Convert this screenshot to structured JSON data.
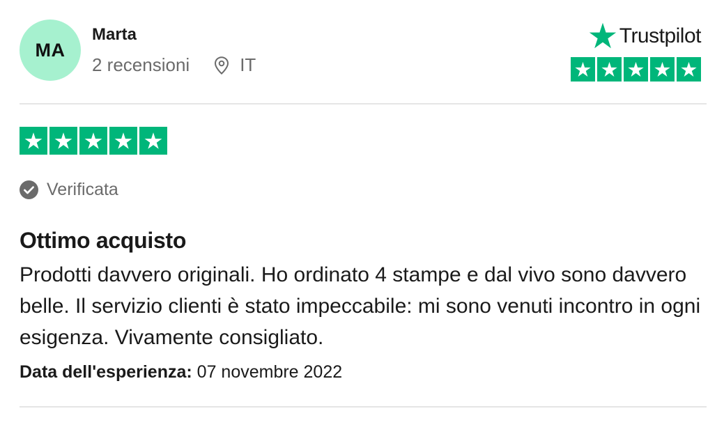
{
  "reviewer": {
    "initials": "MA",
    "name": "Marta",
    "reviews_count": "2 recensioni",
    "country": "IT",
    "avatar_color": "#a6f1cf"
  },
  "brand": {
    "name": "Trustpilot",
    "logo_icon": "trustpilot-star-icon",
    "accent_color": "#00b67a",
    "logo_stars": 5
  },
  "review": {
    "rating": 5,
    "rating_max": 5,
    "verified_label": "Verificata",
    "title": "Ottimo acquisto",
    "body": "Prodotti davvero originali. Ho ordinato 4 stampe e dal vivo sono davvero belle. Il servizio clienti è stato impeccabile: mi sono venuti incontro in ogni esigenza. Vivamente consigliato.",
    "experience_label": "Data dell'esperienza:",
    "experience_date": " 07 novembre 2022"
  },
  "icons": {
    "location": "location-pin-icon",
    "verified": "check-circle-icon",
    "rating_star": "star-icon"
  }
}
